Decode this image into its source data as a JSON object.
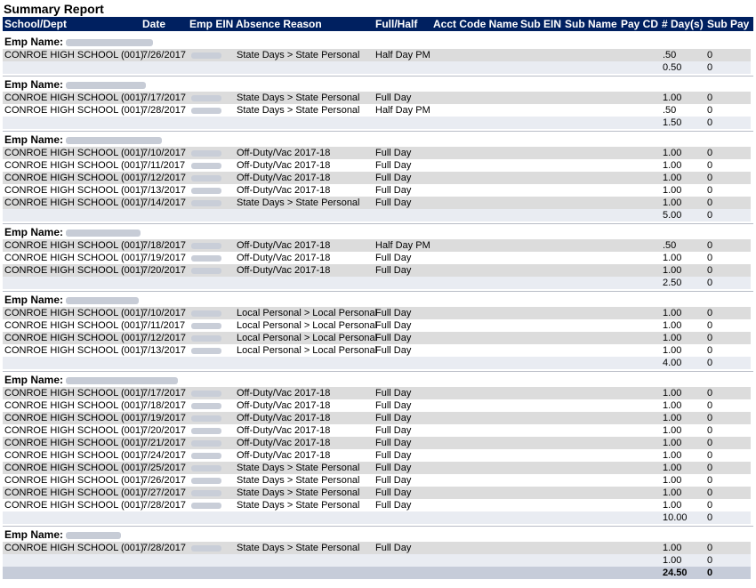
{
  "report": {
    "title": "Summary Report"
  },
  "columns": [
    "School/Dept",
    "Date",
    "Emp EIN",
    "Absence Reason",
    "Full/Half",
    "Acct Code Name",
    "Sub EIN",
    "Sub Name",
    "Pay CD",
    "# Day(s)",
    "Sub Pay"
  ],
  "emp_label": "Emp Name:",
  "groups": [
    {
      "rows": [
        {
          "school": "CONROE HIGH SCHOOL (001)",
          "date": "7/26/2017",
          "reason": "State Days > State Personal",
          "fullhalf": "Half Day PM",
          "days": ".50",
          "subpay": "0"
        }
      ],
      "subtotal_days": "0.50",
      "subtotal_pay": "0"
    },
    {
      "rows": [
        {
          "school": "CONROE HIGH SCHOOL (001)",
          "date": "7/17/2017",
          "reason": "State Days > State Personal",
          "fullhalf": "Full Day",
          "days": "1.00",
          "subpay": "0"
        },
        {
          "school": "CONROE HIGH SCHOOL (001)",
          "date": "7/28/2017",
          "reason": "State Days > State Personal",
          "fullhalf": "Half Day PM",
          "days": ".50",
          "subpay": "0"
        }
      ],
      "subtotal_days": "1.50",
      "subtotal_pay": "0"
    },
    {
      "rows": [
        {
          "school": "CONROE HIGH SCHOOL (001)",
          "date": "7/10/2017",
          "reason": "Off-Duty/Vac 2017-18",
          "fullhalf": "Full Day",
          "days": "1.00",
          "subpay": "0"
        },
        {
          "school": "CONROE HIGH SCHOOL (001)",
          "date": "7/11/2017",
          "reason": "Off-Duty/Vac 2017-18",
          "fullhalf": "Full Day",
          "days": "1.00",
          "subpay": "0"
        },
        {
          "school": "CONROE HIGH SCHOOL (001)",
          "date": "7/12/2017",
          "reason": "Off-Duty/Vac 2017-18",
          "fullhalf": "Full Day",
          "days": "1.00",
          "subpay": "0"
        },
        {
          "school": "CONROE HIGH SCHOOL (001)",
          "date": "7/13/2017",
          "reason": "Off-Duty/Vac 2017-18",
          "fullhalf": "Full Day",
          "days": "1.00",
          "subpay": "0"
        },
        {
          "school": "CONROE HIGH SCHOOL (001)",
          "date": "7/14/2017",
          "reason": "State Days > State Personal",
          "fullhalf": "Full Day",
          "days": "1.00",
          "subpay": "0"
        }
      ],
      "subtotal_days": "5.00",
      "subtotal_pay": "0"
    },
    {
      "rows": [
        {
          "school": "CONROE HIGH SCHOOL (001)",
          "date": "7/18/2017",
          "reason": "Off-Duty/Vac 2017-18",
          "fullhalf": "Half Day PM",
          "days": ".50",
          "subpay": "0"
        },
        {
          "school": "CONROE HIGH SCHOOL (001)",
          "date": "7/19/2017",
          "reason": "Off-Duty/Vac 2017-18",
          "fullhalf": "Full Day",
          "days": "1.00",
          "subpay": "0"
        },
        {
          "school": "CONROE HIGH SCHOOL (001)",
          "date": "7/20/2017",
          "reason": "Off-Duty/Vac 2017-18",
          "fullhalf": "Full Day",
          "days": "1.00",
          "subpay": "0"
        }
      ],
      "subtotal_days": "2.50",
      "subtotal_pay": "0"
    },
    {
      "rows": [
        {
          "school": "CONROE HIGH SCHOOL (001)",
          "date": "7/10/2017",
          "reason": "Local Personal > Local Personal",
          "fullhalf": "Full Day",
          "days": "1.00",
          "subpay": "0"
        },
        {
          "school": "CONROE HIGH SCHOOL (001)",
          "date": "7/11/2017",
          "reason": "Local Personal > Local Personal",
          "fullhalf": "Full Day",
          "days": "1.00",
          "subpay": "0"
        },
        {
          "school": "CONROE HIGH SCHOOL (001)",
          "date": "7/12/2017",
          "reason": "Local Personal > Local Personal",
          "fullhalf": "Full Day",
          "days": "1.00",
          "subpay": "0"
        },
        {
          "school": "CONROE HIGH SCHOOL (001)",
          "date": "7/13/2017",
          "reason": "Local Personal > Local Personal",
          "fullhalf": "Full Day",
          "days": "1.00",
          "subpay": "0"
        }
      ],
      "subtotal_days": "4.00",
      "subtotal_pay": "0"
    },
    {
      "rows": [
        {
          "school": "CONROE HIGH SCHOOL (001)",
          "date": "7/17/2017",
          "reason": "Off-Duty/Vac 2017-18",
          "fullhalf": "Full Day",
          "days": "1.00",
          "subpay": "0"
        },
        {
          "school": "CONROE HIGH SCHOOL (001)",
          "date": "7/18/2017",
          "reason": "Off-Duty/Vac 2017-18",
          "fullhalf": "Full Day",
          "days": "1.00",
          "subpay": "0"
        },
        {
          "school": "CONROE HIGH SCHOOL (001)",
          "date": "7/19/2017",
          "reason": "Off-Duty/Vac 2017-18",
          "fullhalf": "Full Day",
          "days": "1.00",
          "subpay": "0"
        },
        {
          "school": "CONROE HIGH SCHOOL (001)",
          "date": "7/20/2017",
          "reason": "Off-Duty/Vac 2017-18",
          "fullhalf": "Full Day",
          "days": "1.00",
          "subpay": "0"
        },
        {
          "school": "CONROE HIGH SCHOOL (001)",
          "date": "7/21/2017",
          "reason": "Off-Duty/Vac 2017-18",
          "fullhalf": "Full Day",
          "days": "1.00",
          "subpay": "0"
        },
        {
          "school": "CONROE HIGH SCHOOL (001)",
          "date": "7/24/2017",
          "reason": "Off-Duty/Vac 2017-18",
          "fullhalf": "Full Day",
          "days": "1.00",
          "subpay": "0"
        },
        {
          "school": "CONROE HIGH SCHOOL (001)",
          "date": "7/25/2017",
          "reason": "State Days > State Personal",
          "fullhalf": "Full Day",
          "days": "1.00",
          "subpay": "0"
        },
        {
          "school": "CONROE HIGH SCHOOL (001)",
          "date": "7/26/2017",
          "reason": "State Days > State Personal",
          "fullhalf": "Full Day",
          "days": "1.00",
          "subpay": "0"
        },
        {
          "school": "CONROE HIGH SCHOOL (001)",
          "date": "7/27/2017",
          "reason": "State Days > State Personal",
          "fullhalf": "Full Day",
          "days": "1.00",
          "subpay": "0"
        },
        {
          "school": "CONROE HIGH SCHOOL (001)",
          "date": "7/28/2017",
          "reason": "State Days > State Personal",
          "fullhalf": "Full Day",
          "days": "1.00",
          "subpay": "0"
        }
      ],
      "subtotal_days": "10.00",
      "subtotal_pay": "0"
    },
    {
      "rows": [
        {
          "school": "CONROE HIGH SCHOOL (001)",
          "date": "7/28/2017",
          "reason": "State Days > State Personal",
          "fullhalf": "Full Day",
          "days": "1.00",
          "subpay": "0"
        }
      ],
      "subtotal_days": "1.00",
      "subtotal_pay": "0"
    }
  ],
  "grand_total": {
    "days": "24.50",
    "subpay": "0"
  },
  "colors": {
    "header_bg": "#002060",
    "row_alt": "#dcdcdc",
    "subtotal_bg": "#e9ecf2",
    "grand_bg": "#c6ccd9"
  }
}
